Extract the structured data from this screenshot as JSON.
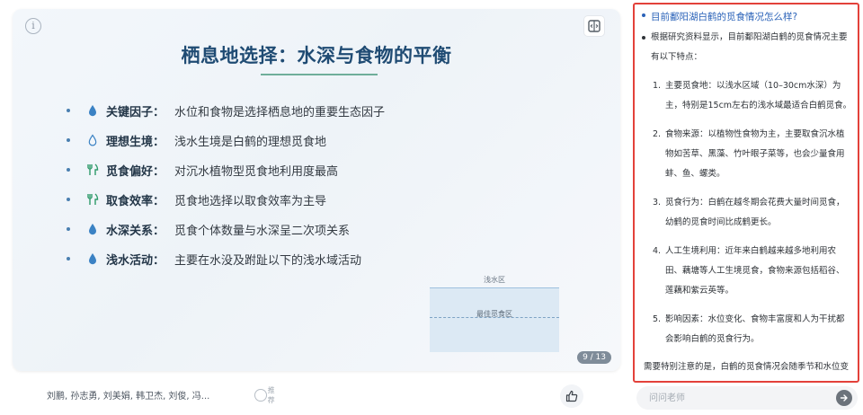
{
  "slide": {
    "title": "栖息地选择：水深与食物的平衡",
    "bullets": [
      {
        "icon": "water-drop-icon",
        "label": "关键因子：",
        "text": "水位和食物是选择栖息地的重要生态因子"
      },
      {
        "icon": "water-drop-outline-icon",
        "label": "理想生境：",
        "text": "浅水生境是白鹤的理想觅食地"
      },
      {
        "icon": "fork-knife-icon",
        "label": "觅食偏好：",
        "text": "对沉水植物型觅食地利用度最高"
      },
      {
        "icon": "fork-knife-icon",
        "label": "取食效率：",
        "text": "觅食地选择以取食效率为主导"
      },
      {
        "icon": "water-drop-icon",
        "label": "水深关系：",
        "text": "觅食个体数量与水深呈二次项关系"
      },
      {
        "icon": "water-drop-icon",
        "label": "浅水活动：",
        "text": "主要在水没及跗趾以下的浅水域活动"
      }
    ],
    "diagram": {
      "top_label": "浅水区",
      "middle_label": "最佳觅食区"
    },
    "page_indicator": "9 / 13"
  },
  "footer": {
    "authors": "刘鹏, 孙志勇, 刘美娟, 韩卫杰, 刘俊, 冯...",
    "recommend_label": "推荐"
  },
  "chat": {
    "question": "目前鄱阳湖白鹤的觅食情况怎么样?",
    "intro": "根据研究资料显示，目前鄱阳湖白鹤的觅食情况主要有以下特点：",
    "items": [
      {
        "num": "1.",
        "text": "主要觅食地：以浅水区域（10–30cm水深）为主，特别是15cm左右的浅水域最适合白鹤觅食。"
      },
      {
        "num": "2.",
        "text": "食物来源：以植物性食物为主，主要取食沉水植物如苦草、黑藻、竹叶眼子菜等，也会少量食用蚌、鱼、螺类。"
      },
      {
        "num": "3.",
        "text": "觅食行为：白鹤在越冬期会花费大量时间觅食，幼鹤的觅食时间比成鹤更长。"
      },
      {
        "num": "4.",
        "text": "人工生境利用：近年来白鹤越来越多地利用农田、藕塘等人工生境觅食，食物来源包括稻谷、莲藕和紫云英等。"
      },
      {
        "num": "5.",
        "text": "影响因素：水位变化、食物丰富度和人为干扰都会影响白鹤的觅食行为。"
      }
    ],
    "note": "需要特别注意的是，白鹤的觅食情况会随季节和水位变化而有所调整。",
    "input_placeholder": "问问老师"
  },
  "colors": {
    "accent": "#2a62b8",
    "highlight_border": "#e3413a",
    "title": "#1f4b73",
    "underline": "#6fae9a"
  }
}
